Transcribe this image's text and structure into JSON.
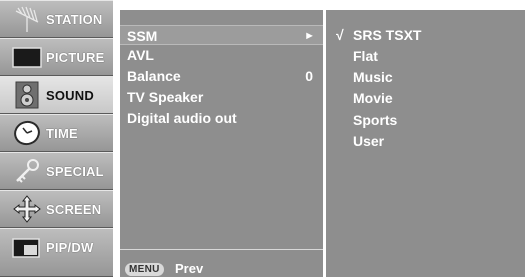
{
  "sidebar": {
    "items": [
      {
        "label": "STATION",
        "icon": "antenna-icon"
      },
      {
        "label": "PICTURE",
        "icon": "tv-screen-icon"
      },
      {
        "label": "SOUND",
        "icon": "speaker-icon",
        "active": true
      },
      {
        "label": "TIME",
        "icon": "clock-icon"
      },
      {
        "label": "SPECIAL",
        "icon": "key-icon"
      },
      {
        "label": "SCREEN",
        "icon": "move-arrows-icon"
      },
      {
        "label": "PIP/DW",
        "icon": "pip-icon"
      }
    ]
  },
  "sound_menu": {
    "items": [
      {
        "label": "SSM",
        "arrow": "►"
      },
      {
        "label": "AVL"
      },
      {
        "label": "Balance",
        "value": "0"
      },
      {
        "label": "TV Speaker"
      },
      {
        "label": "Digital audio out"
      }
    ],
    "footer": {
      "key": "MENU",
      "action": "Prev"
    }
  },
  "ssm_options": {
    "check_mark": "√",
    "items": [
      {
        "label": "SRS TSXT",
        "checked": true
      },
      {
        "label": "Flat"
      },
      {
        "label": "Music"
      },
      {
        "label": "Movie"
      },
      {
        "label": "Sports"
      },
      {
        "label": "User"
      }
    ]
  },
  "colors": {
    "panel": "#8e8e8e",
    "sidebar_active": "#d8d8d8",
    "text": "#ffffff"
  }
}
